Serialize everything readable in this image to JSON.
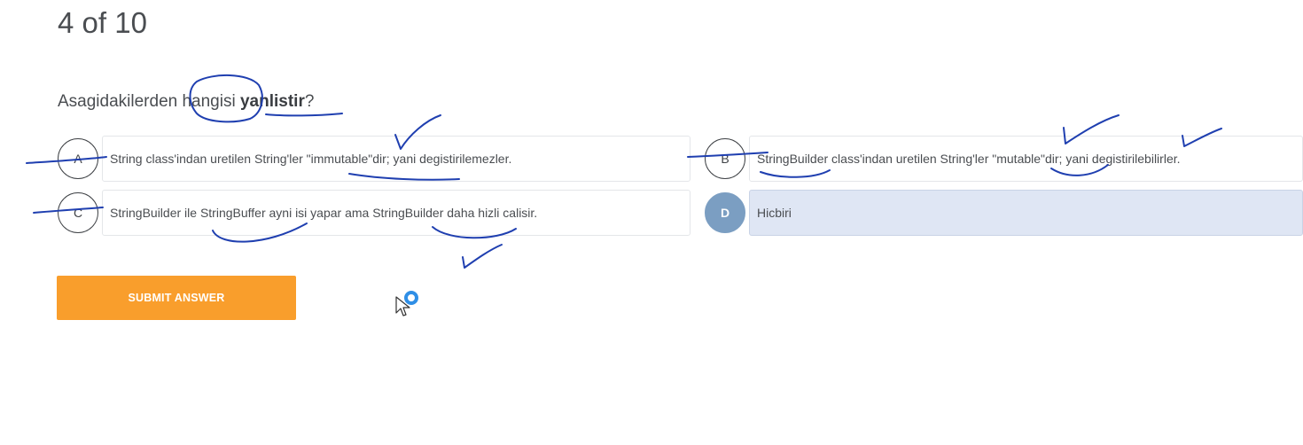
{
  "progress": {
    "text": "4 of 10"
  },
  "question": {
    "prefix": "Asagidakilerden ",
    "highlight_word": "hangisi",
    "bold_word": "yanlistir",
    "suffix": "?"
  },
  "options": [
    {
      "letter": "A",
      "text": "String class'indan uretilen String'ler \"immutable\"dir;  yani degistirilemezler.",
      "selected": false
    },
    {
      "letter": "B",
      "text": "StringBuilder class'indan uretilen String'ler \"mutable\"dir;  yani degistirilebilirler.",
      "selected": false
    },
    {
      "letter": "C",
      "text": "StringBuilder ile StringBuffer ayni isi yapar ama StringBuilder daha hizli calisir.",
      "selected": false
    },
    {
      "letter": "D",
      "text": "Hicbiri",
      "selected": true
    }
  ],
  "submit": {
    "label": "SUBMIT ANSWER"
  },
  "colors": {
    "accent_orange": "#f99e2c",
    "selected_badge": "#7b9ec2",
    "selected_option_bg": "#dfe6f4",
    "annotation_ink": "#1f3fb0"
  },
  "icons": {
    "cursor": "mouse-pointer-icon",
    "click_indicator": "click-ring-icon"
  }
}
